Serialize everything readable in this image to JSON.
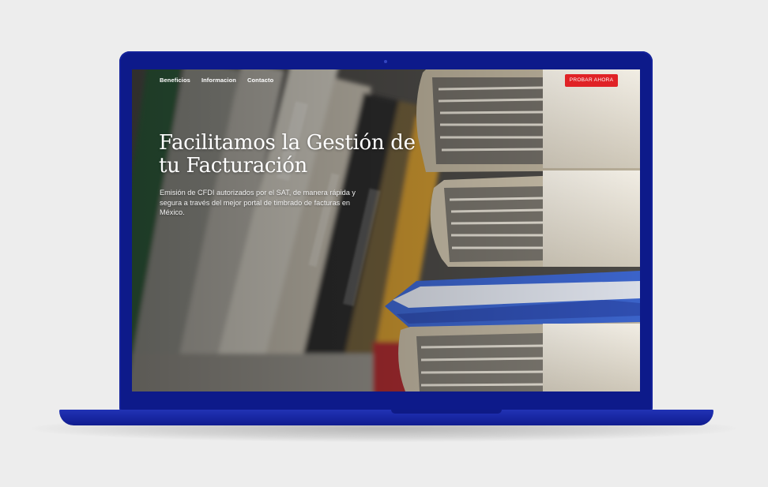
{
  "nav": {
    "items": [
      {
        "label": "Beneficios"
      },
      {
        "label": "Informacion"
      },
      {
        "label": "Contacto"
      }
    ],
    "cta_label": "PROBAR AHORA"
  },
  "hero": {
    "title": "Facilitamos la Gestión de tu Facturación",
    "subtitle": "Emisión de CFDI autorizados por el SAT, de manera rápida y segura a través del mejor portal de timbrado de facturas en México."
  },
  "colors": {
    "laptop": "#0d1a8a",
    "cta": "#e02226",
    "background": "#ededed"
  }
}
